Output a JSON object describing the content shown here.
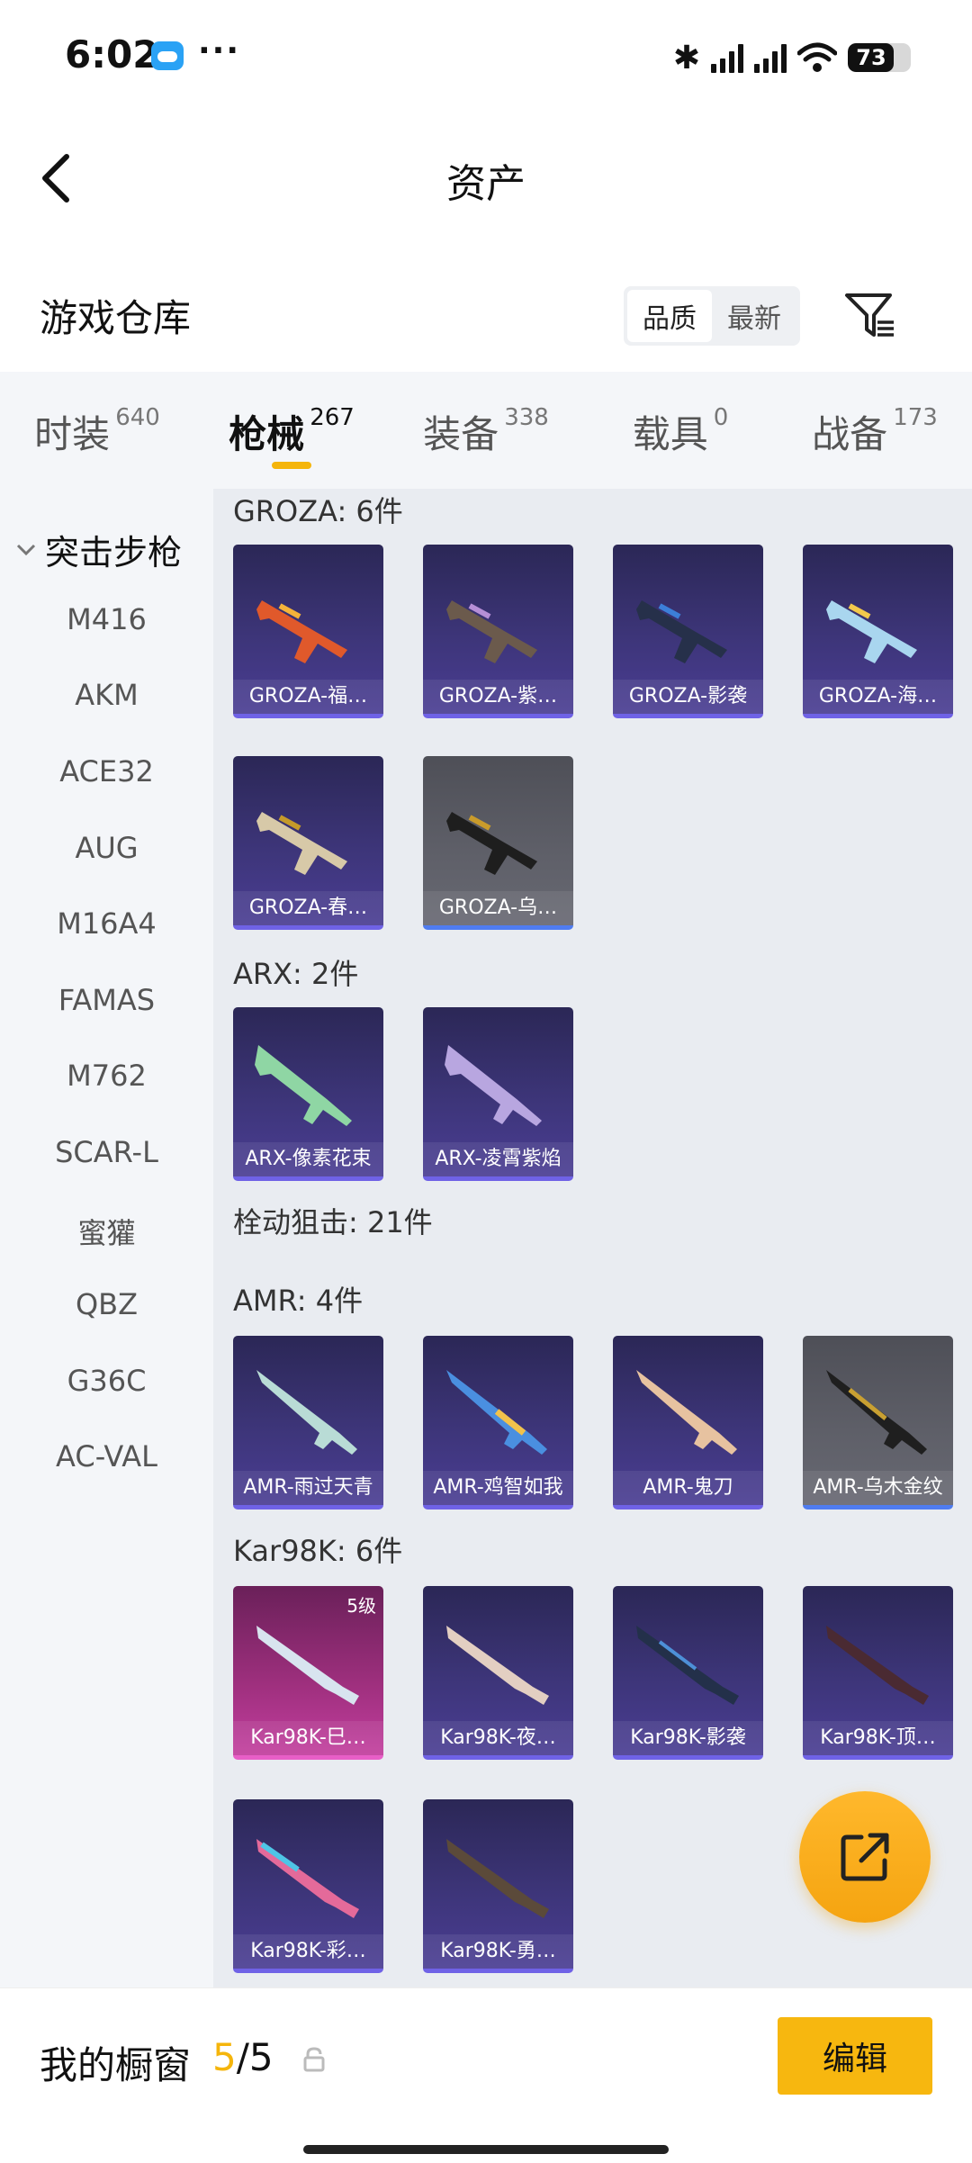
{
  "status": {
    "time": "6:02",
    "more": "···",
    "battery": "73"
  },
  "header": {
    "title": "资产"
  },
  "sub": {
    "title": "游戏仓库",
    "sort": [
      "品质",
      "最新"
    ]
  },
  "tabs": [
    {
      "label": "时装",
      "count": "640"
    },
    {
      "label": "枪械",
      "count": "267"
    },
    {
      "label": "装备",
      "count": "338"
    },
    {
      "label": "载具",
      "count": "0"
    },
    {
      "label": "战备",
      "count": "173"
    }
  ],
  "sidebar": {
    "group": "突击步枪",
    "items": [
      "M416",
      "AKM",
      "ACE32",
      "AUG",
      "M16A4",
      "FAMAS",
      "M762",
      "SCAR-L",
      "蜜獾",
      "QBZ",
      "G36C",
      "AC-VAL"
    ]
  },
  "sections": {
    "groza": "GROZA: 6件",
    "arx": "ARX: 2件",
    "sniper": "栓动狙击: 21件",
    "amr": "AMR: 4件",
    "kar": "Kar98K: 6件"
  },
  "cards": {
    "groza": [
      "GROZA-福…",
      "GROZA-紫…",
      "GROZA-影袭",
      "GROZA-海…",
      "GROZA-春…",
      "GROZA-乌…"
    ],
    "arx": [
      "ARX-像素花束",
      "ARX-凌霄紫焰"
    ],
    "amr": [
      "AMR-雨过天青",
      "AMR-鸡智如我",
      "AMR-鬼刀",
      "AMR-乌木金纹"
    ],
    "kar": [
      "Kar98K-巳…",
      "Kar98K-夜…",
      "Kar98K-影袭",
      "Kar98K-顶…",
      "Kar98K-彩…",
      "Kar98K-勇…"
    ],
    "kar_level": "5级"
  },
  "bottom": {
    "label": "我的橱窗",
    "current": "5",
    "total": "/5",
    "edit": "编辑"
  }
}
